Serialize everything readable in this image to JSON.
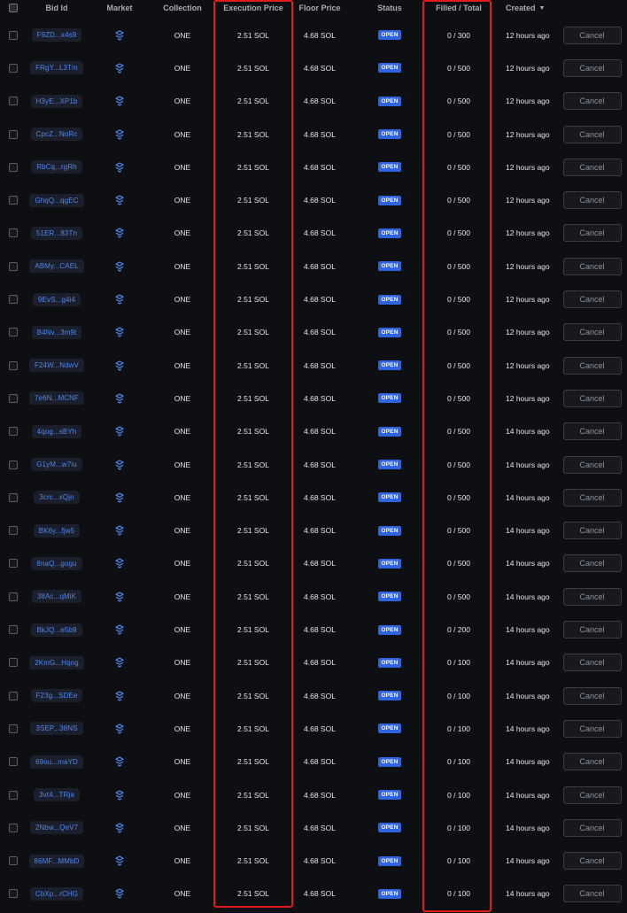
{
  "header": {
    "bid_id": "Bid Id",
    "market": "Market",
    "collection": "Collection",
    "execution_price": "Execution Price",
    "floor_price": "Floor Price",
    "status": "Status",
    "filled_total": "Filled / Total",
    "created": "Created",
    "created_sort_icon": "caret-down-icon"
  },
  "market_icon": "magic-eden-icon",
  "accent_colors": {
    "link": "#4f86f0",
    "status_open": "#2f63e0",
    "highlight": "#e01b1b"
  },
  "rows": [
    {
      "bid": "F9ZD...x4s9",
      "collection": "ONE",
      "exec": "2.51 SOL",
      "floor": "4.68 SOL",
      "status": "OPEN",
      "filled": "0 / 300",
      "created": "12 hours ago",
      "action": "Cancel"
    },
    {
      "bid": "FRgY...L3Tm",
      "collection": "ONE",
      "exec": "2.51 SOL",
      "floor": "4.68 SOL",
      "status": "OPEN",
      "filled": "0 / 500",
      "created": "12 hours ago",
      "action": "Cancel"
    },
    {
      "bid": "H3yE...XP1b",
      "collection": "ONE",
      "exec": "2.51 SOL",
      "floor": "4.68 SOL",
      "status": "OPEN",
      "filled": "0 / 500",
      "created": "12 hours ago",
      "action": "Cancel"
    },
    {
      "bid": "CpcZ...NoRc",
      "collection": "ONE",
      "exec": "2.51 SOL",
      "floor": "4.68 SOL",
      "status": "OPEN",
      "filled": "0 / 500",
      "created": "12 hours ago",
      "action": "Cancel"
    },
    {
      "bid": "RbCq...rgRh",
      "collection": "ONE",
      "exec": "2.51 SOL",
      "floor": "4.68 SOL",
      "status": "OPEN",
      "filled": "0 / 500",
      "created": "12 hours ago",
      "action": "Cancel"
    },
    {
      "bid": "GhqQ...qgEC",
      "collection": "ONE",
      "exec": "2.51 SOL",
      "floor": "4.68 SOL",
      "status": "OPEN",
      "filled": "0 / 500",
      "created": "12 hours ago",
      "action": "Cancel"
    },
    {
      "bid": "51ER...83Tn",
      "collection": "ONE",
      "exec": "2.51 SOL",
      "floor": "4.68 SOL",
      "status": "OPEN",
      "filled": "0 / 500",
      "created": "12 hours ago",
      "action": "Cancel"
    },
    {
      "bid": "ABMy...CAEL",
      "collection": "ONE",
      "exec": "2.51 SOL",
      "floor": "4.68 SOL",
      "status": "OPEN",
      "filled": "0 / 500",
      "created": "12 hours ago",
      "action": "Cancel"
    },
    {
      "bid": "9EvS...g4i4",
      "collection": "ONE",
      "exec": "2.51 SOL",
      "floor": "4.68 SOL",
      "status": "OPEN",
      "filled": "0 / 500",
      "created": "12 hours ago",
      "action": "Cancel"
    },
    {
      "bid": "B4Nv...3m9t",
      "collection": "ONE",
      "exec": "2.51 SOL",
      "floor": "4.68 SOL",
      "status": "OPEN",
      "filled": "0 / 500",
      "created": "12 hours ago",
      "action": "Cancel"
    },
    {
      "bid": "F24W...NdwV",
      "collection": "ONE",
      "exec": "2.51 SOL",
      "floor": "4.68 SOL",
      "status": "OPEN",
      "filled": "0 / 500",
      "created": "12 hours ago",
      "action": "Cancel"
    },
    {
      "bid": "7e6N...MCNF",
      "collection": "ONE",
      "exec": "2.51 SOL",
      "floor": "4.68 SOL",
      "status": "OPEN",
      "filled": "0 / 500",
      "created": "12 hours ago",
      "action": "Cancel"
    },
    {
      "bid": "4qog...sBYh",
      "collection": "ONE",
      "exec": "2.51 SOL",
      "floor": "4.68 SOL",
      "status": "OPEN",
      "filled": "0 / 500",
      "created": "14 hours ago",
      "action": "Cancel"
    },
    {
      "bid": "G1yM...w7iu",
      "collection": "ONE",
      "exec": "2.51 SOL",
      "floor": "4.68 SOL",
      "status": "OPEN",
      "filled": "0 / 500",
      "created": "14 hours ago",
      "action": "Cancel"
    },
    {
      "bid": "3crc...xQjn",
      "collection": "ONE",
      "exec": "2.51 SOL",
      "floor": "4.68 SOL",
      "status": "OPEN",
      "filled": "0 / 500",
      "created": "14 hours ago",
      "action": "Cancel"
    },
    {
      "bid": "BK6y...fjw5",
      "collection": "ONE",
      "exec": "2.51 SOL",
      "floor": "4.68 SOL",
      "status": "OPEN",
      "filled": "0 / 500",
      "created": "14 hours ago",
      "action": "Cancel"
    },
    {
      "bid": "8naQ...gogu",
      "collection": "ONE",
      "exec": "2.51 SOL",
      "floor": "4.68 SOL",
      "status": "OPEN",
      "filled": "0 / 500",
      "created": "14 hours ago",
      "action": "Cancel"
    },
    {
      "bid": "38Ac...qMiK",
      "collection": "ONE",
      "exec": "2.51 SOL",
      "floor": "4.68 SOL",
      "status": "OPEN",
      "filled": "0 / 500",
      "created": "14 hours ago",
      "action": "Cancel"
    },
    {
      "bid": "BkJQ...e5b9",
      "collection": "ONE",
      "exec": "2.51 SOL",
      "floor": "4.68 SOL",
      "status": "OPEN",
      "filled": "0 / 200",
      "created": "14 hours ago",
      "action": "Cancel"
    },
    {
      "bid": "2KmG...Hqog",
      "collection": "ONE",
      "exec": "2.51 SOL",
      "floor": "4.68 SOL",
      "status": "OPEN",
      "filled": "0 / 100",
      "created": "14 hours ago",
      "action": "Cancel"
    },
    {
      "bid": "F23g...SDEe",
      "collection": "ONE",
      "exec": "2.51 SOL",
      "floor": "4.68 SOL",
      "status": "OPEN",
      "filled": "0 / 100",
      "created": "14 hours ago",
      "action": "Cancel"
    },
    {
      "bid": "3SEP...38NS",
      "collection": "ONE",
      "exec": "2.51 SOL",
      "floor": "4.68 SOL",
      "status": "OPEN",
      "filled": "0 / 100",
      "created": "14 hours ago",
      "action": "Cancel"
    },
    {
      "bid": "69ou...maYD",
      "collection": "ONE",
      "exec": "2.51 SOL",
      "floor": "4.68 SOL",
      "status": "OPEN",
      "filled": "0 / 100",
      "created": "14 hours ago",
      "action": "Cancel"
    },
    {
      "bid": "3vt4...TRja",
      "collection": "ONE",
      "exec": "2.51 SOL",
      "floor": "4.68 SOL",
      "status": "OPEN",
      "filled": "0 / 100",
      "created": "14 hours ago",
      "action": "Cancel"
    },
    {
      "bid": "2Nbw...QeV7",
      "collection": "ONE",
      "exec": "2.51 SOL",
      "floor": "4.68 SOL",
      "status": "OPEN",
      "filled": "0 / 100",
      "created": "14 hours ago",
      "action": "Cancel"
    },
    {
      "bid": "86MF...MMbD",
      "collection": "ONE",
      "exec": "2.51 SOL",
      "floor": "4.68 SOL",
      "status": "OPEN",
      "filled": "0 / 100",
      "created": "14 hours ago",
      "action": "Cancel"
    },
    {
      "bid": "CbXp...rCHG",
      "collection": "ONE",
      "exec": "2.51 SOL",
      "floor": "4.68 SOL",
      "status": "OPEN",
      "filled": "0 / 100",
      "created": "14 hours ago",
      "action": "Cancel"
    }
  ]
}
